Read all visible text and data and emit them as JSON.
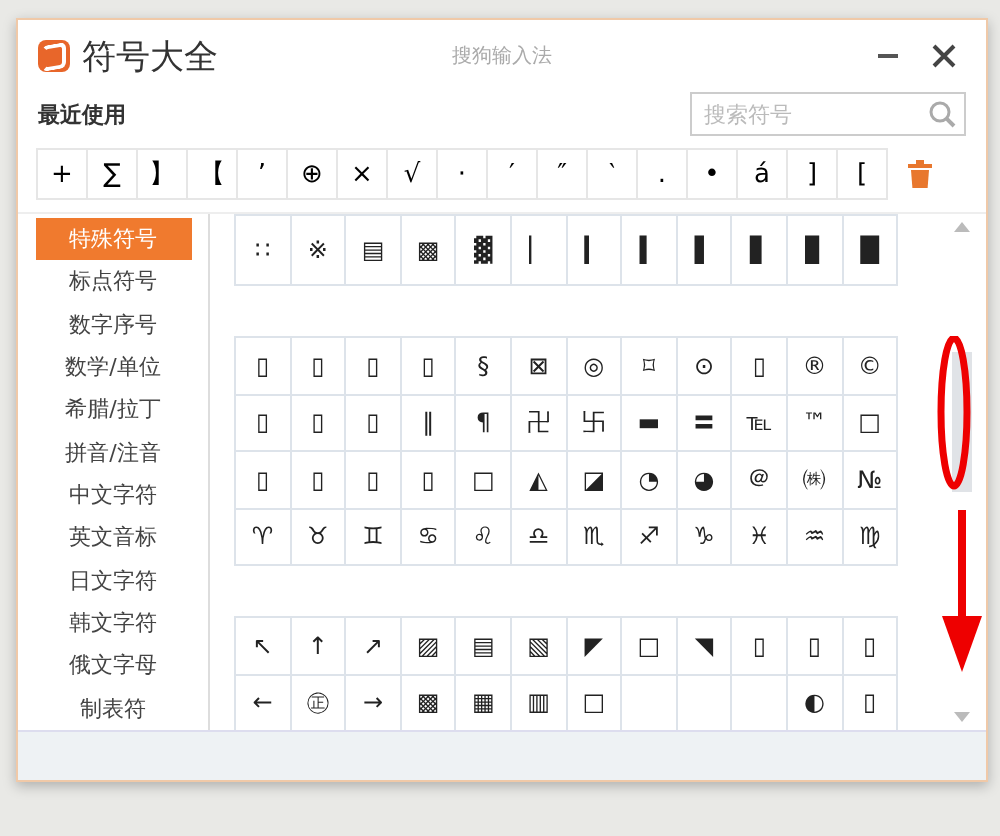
{
  "window": {
    "title": "符号大全",
    "app_name": "搜狗输入法"
  },
  "recent": {
    "label": "最近使用",
    "search": {
      "placeholder": "搜索符号"
    },
    "symbols": [
      "+",
      "∑",
      "】",
      "【",
      "’",
      "⊕",
      "×",
      "√",
      "·",
      "′",
      "″",
      "‵",
      ".",
      "•",
      "á",
      "]",
      "["
    ]
  },
  "sidebar": {
    "items": [
      {
        "label": "特殊符号",
        "selected": true
      },
      {
        "label": "标点符号",
        "selected": false
      },
      {
        "label": "数字序号",
        "selected": false
      },
      {
        "label": "数学/单位",
        "selected": false
      },
      {
        "label": "希腊/拉丁",
        "selected": false
      },
      {
        "label": "拼音/注音",
        "selected": false
      },
      {
        "label": "中文字符",
        "selected": false
      },
      {
        "label": "英文音标",
        "selected": false
      },
      {
        "label": "日文字符",
        "selected": false
      },
      {
        "label": "韩文字符",
        "selected": false
      },
      {
        "label": "俄文字母",
        "selected": false
      },
      {
        "label": "制表符",
        "selected": false
      }
    ]
  },
  "symbol_groups": [
    {
      "rows": [
        [
          "∷",
          "※",
          "▤",
          "▩",
          "▓",
          "▏",
          "▎",
          "▍",
          "▌",
          "▋",
          "▊",
          "█"
        ]
      ]
    },
    {
      "rows": [
        [
          "▯",
          "▯",
          "▯",
          "▯",
          "§",
          "⊠",
          "◎",
          "⌑",
          "⊙",
          "▯",
          "®",
          "©"
        ],
        [
          "▯",
          "▯",
          "▯",
          "‖",
          "¶",
          "卍",
          "卐",
          "▬",
          "〓",
          "℡",
          "™",
          "□"
        ],
        [
          "▯",
          "▯",
          "▯",
          "▯",
          "□",
          "◭",
          "◪",
          "◔",
          "◕",
          "＠",
          "㈱",
          "№"
        ],
        [
          "♈",
          "♉",
          "♊",
          "♋",
          "♌",
          "♎",
          "♏",
          "♐",
          "♑",
          "♓",
          "♒",
          "♍"
        ]
      ]
    },
    {
      "rows": [
        [
          "↖",
          "↑",
          "↗",
          "▨",
          "▤",
          "▧",
          "◤",
          "□",
          "◥",
          "▯",
          "▯",
          "▯"
        ],
        [
          "←",
          "㊣",
          "→",
          "▩",
          "▦",
          "▥",
          "□",
          null,
          null,
          null,
          "◐",
          "▯"
        ]
      ]
    }
  ]
}
